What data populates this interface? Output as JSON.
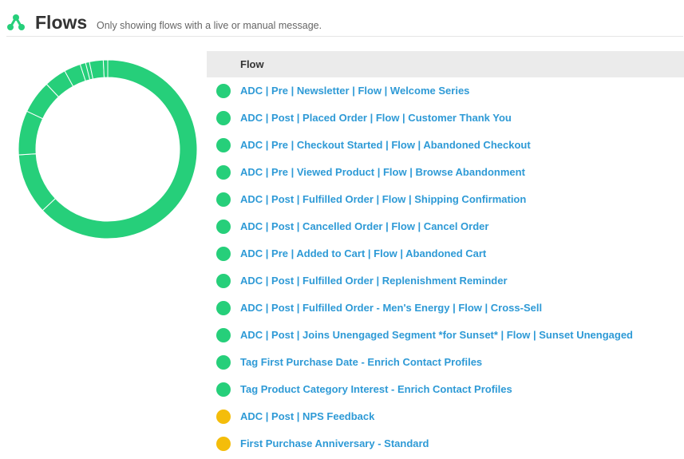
{
  "header": {
    "title": "Flows",
    "subtitle": "Only showing flows with a live or manual message."
  },
  "colors": {
    "live": "#26cf7a",
    "manual": "#f4bd0b",
    "link": "#2e9ad6"
  },
  "chart_data": {
    "type": "donut",
    "segments": [
      {
        "value": 63
      },
      {
        "value": 11
      },
      {
        "value": 8
      },
      {
        "value": 6
      },
      {
        "value": 4
      },
      {
        "value": 3
      },
      {
        "value": 1
      },
      {
        "value": 0.7
      },
      {
        "value": 2.5
      },
      {
        "value": 0.8
      }
    ]
  },
  "table": {
    "column_header": "Flow",
    "rows": [
      {
        "name": "ADC | Pre | Newsletter | Flow | Welcome Series",
        "status": "live"
      },
      {
        "name": "ADC | Post | Placed Order | Flow | Customer Thank You",
        "status": "live"
      },
      {
        "name": "ADC | Pre | Checkout Started | Flow | Abandoned Checkout",
        "status": "live"
      },
      {
        "name": "ADC | Pre | Viewed Product | Flow | Browse Abandonment",
        "status": "live"
      },
      {
        "name": "ADC | Post | Fulfilled Order | Flow | Shipping Confirmation",
        "status": "live"
      },
      {
        "name": "ADC | Post | Cancelled Order | Flow | Cancel Order",
        "status": "live"
      },
      {
        "name": "ADC | Pre | Added to Cart | Flow | Abandoned Cart",
        "status": "live"
      },
      {
        "name": "ADC | Post | Fulfilled Order | Replenishment Reminder",
        "status": "live"
      },
      {
        "name": "ADC | Post | Fulfilled Order - Men's Energy | Flow | Cross-Sell",
        "status": "live"
      },
      {
        "name": "ADC | Post | Joins Unengaged Segment *for Sunset* | Flow | Sunset Unengaged",
        "status": "live"
      },
      {
        "name": "Tag First Purchase Date - Enrich Contact Profiles",
        "status": "live"
      },
      {
        "name": "Tag Product Category Interest - Enrich Contact Profiles",
        "status": "live"
      },
      {
        "name": "ADC | Post | NPS Feedback",
        "status": "manual"
      },
      {
        "name": "First Purchase Anniversary - Standard",
        "status": "manual"
      }
    ]
  }
}
